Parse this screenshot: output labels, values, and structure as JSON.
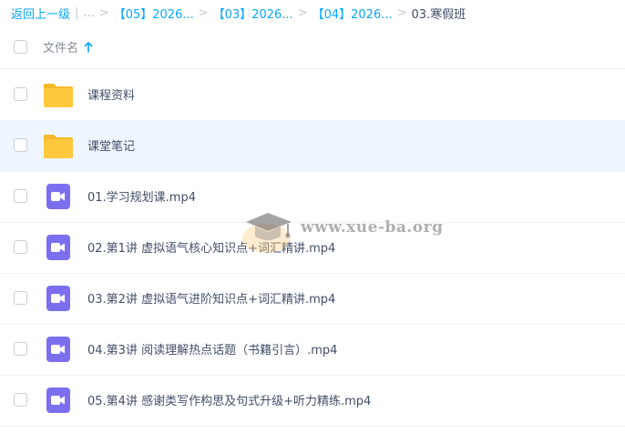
{
  "breadcrumb": {
    "back_label": "返回上一级",
    "divider": "|",
    "ellipsis": "...",
    "separator": ">",
    "crumbs": [
      "【05】2026...",
      "【03】2026...",
      "【04】2026..."
    ],
    "current": "03.寒假班"
  },
  "header": {
    "column_title": "文件名",
    "sort": "ascending"
  },
  "files": [
    {
      "name": "课程资料",
      "type": "folder",
      "selected": false
    },
    {
      "name": "课堂笔记",
      "type": "folder",
      "selected": true
    },
    {
      "name": "01.学习规划课.mp4",
      "type": "video",
      "selected": false
    },
    {
      "name": "02.第1讲 虚拟语气核心知识点+词汇精讲.mp4",
      "type": "video",
      "selected": false
    },
    {
      "name": "03.第2讲 虚拟语气进阶知识点+词汇精讲.mp4",
      "type": "video",
      "selected": false
    },
    {
      "name": "04.第3讲 阅读理解热点话题（书籍引言）.mp4",
      "type": "video",
      "selected": false
    },
    {
      "name": "05.第4讲 感谢类写作构思及句式升级+听力精练.mp4",
      "type": "video",
      "selected": false
    }
  ],
  "watermark": {
    "text": "www.xue-ba.org"
  },
  "colors": {
    "link": "#06a7ff",
    "folder": "#ffc83d",
    "video": "#7b6ff0",
    "selected_row": "#f0f6ff"
  }
}
